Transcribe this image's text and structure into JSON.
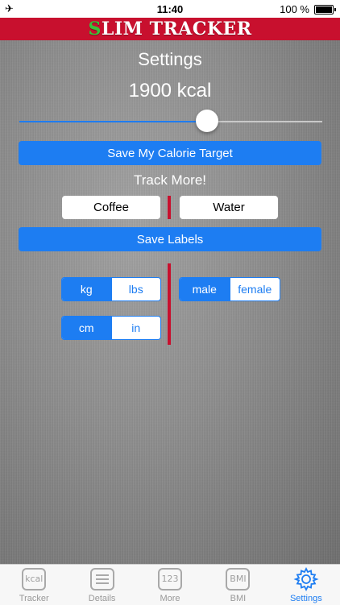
{
  "status_bar": {
    "time": "11:40",
    "battery": "100 %"
  },
  "app": {
    "title_first": "S",
    "title_rest": "LIM TRACKER"
  },
  "settings": {
    "heading": "Settings",
    "calorie_value": "1900 kcal",
    "slider_fraction": 0.62,
    "save_calorie_label": "Save My Calorie Target",
    "track_more_label": "Track More!",
    "label_field_1": "Coffee",
    "label_field_2": "Water",
    "save_labels_label": "Save Labels"
  },
  "units": {
    "weight": {
      "options": [
        "kg",
        "lbs"
      ],
      "selected": "kg"
    },
    "height": {
      "options": [
        "cm",
        "in"
      ],
      "selected": "cm"
    },
    "gender": {
      "options": [
        "male",
        "female"
      ],
      "selected": "male"
    }
  },
  "tabs": [
    {
      "icon": "kcal-icon",
      "icon_text": "kcal",
      "label": "Tracker"
    },
    {
      "icon": "list-icon",
      "icon_text": "",
      "label": "Details"
    },
    {
      "icon": "123-icon",
      "icon_text": "123",
      "label": "More"
    },
    {
      "icon": "bmi-icon",
      "icon_text": "BMI",
      "label": "BMI"
    },
    {
      "icon": "gear-icon",
      "icon_text": "",
      "label": "Settings",
      "active": true
    }
  ],
  "colors": {
    "accent": "#1d7df2",
    "brand_red": "#c8102e",
    "brand_green": "#39c13a"
  }
}
